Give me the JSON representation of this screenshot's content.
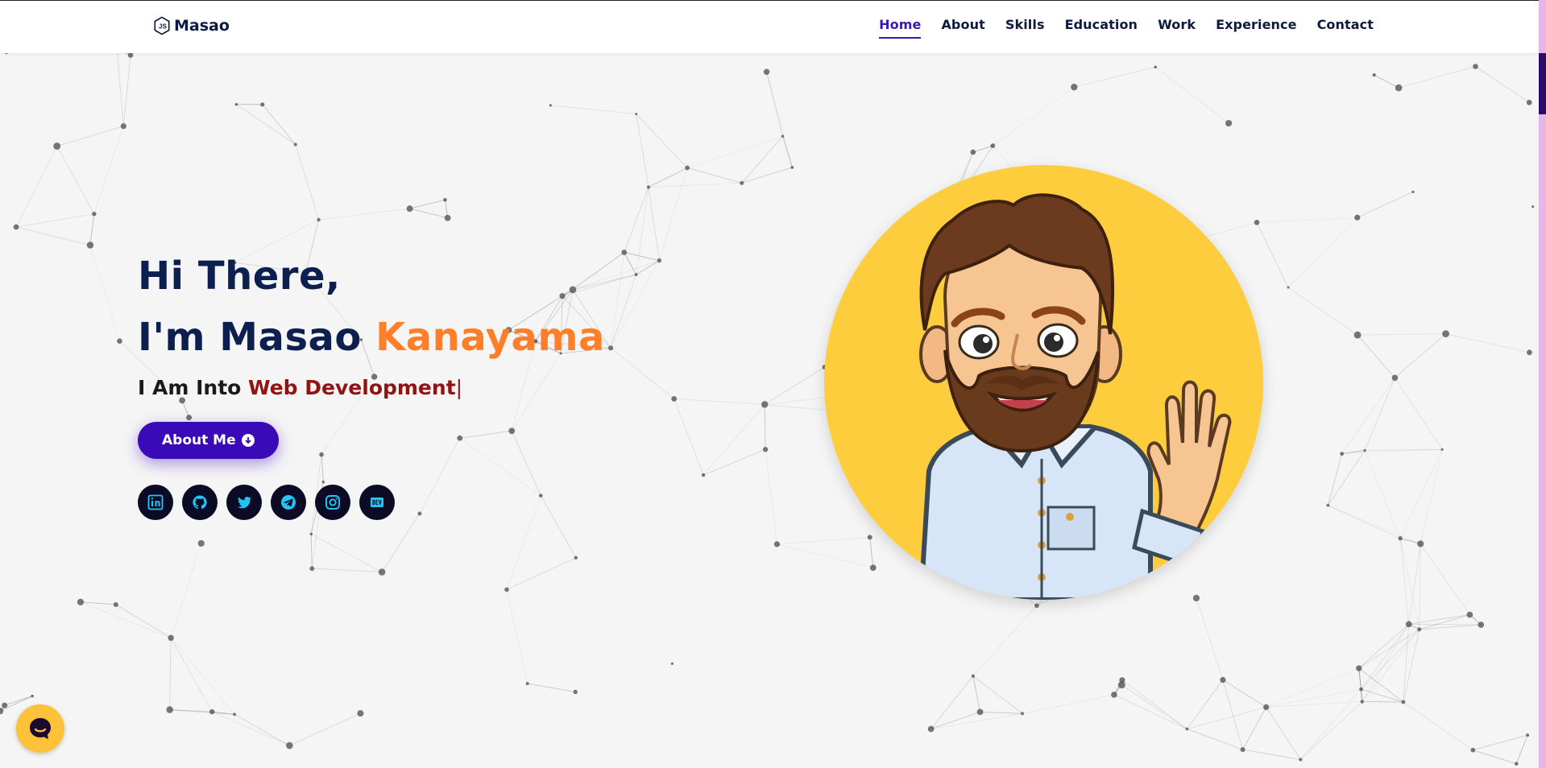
{
  "brand": {
    "name": "Masao",
    "icon": "nodejs-hex-icon"
  },
  "nav": {
    "items": [
      {
        "label": "Home",
        "active": true
      },
      {
        "label": "About",
        "active": false
      },
      {
        "label": "Skills",
        "active": false
      },
      {
        "label": "Education",
        "active": false
      },
      {
        "label": "Work",
        "active": false
      },
      {
        "label": "Experience",
        "active": false
      },
      {
        "label": "Contact",
        "active": false
      }
    ]
  },
  "hero": {
    "greeting": "Hi There,",
    "intro": "I'm Masao ",
    "surname": "Kanayama",
    "typing_prefix": "I Am Into ",
    "typing_role": "Web Development",
    "typing_caret": "|",
    "cta_label": "About Me",
    "cta_icon": "arrow-down-circle-icon"
  },
  "socials": [
    {
      "name": "linkedin",
      "icon": "linkedin-icon"
    },
    {
      "name": "github",
      "icon": "github-icon"
    },
    {
      "name": "twitter",
      "icon": "twitter-icon"
    },
    {
      "name": "telegram",
      "icon": "telegram-icon"
    },
    {
      "name": "instagram",
      "icon": "instagram-icon"
    },
    {
      "name": "dev",
      "icon": "dev-to-icon"
    }
  ],
  "colors": {
    "primary": "#3b0ab8",
    "heading": "#0d1f4f",
    "accent_orange": "#ff7e29",
    "role_red": "#931313",
    "avatar_bg": "#fecd3d",
    "social_bg": "#0b0b26",
    "social_icon": "#21c6f7"
  },
  "chat_widget": {
    "icon": "chat-bubble-icon"
  }
}
